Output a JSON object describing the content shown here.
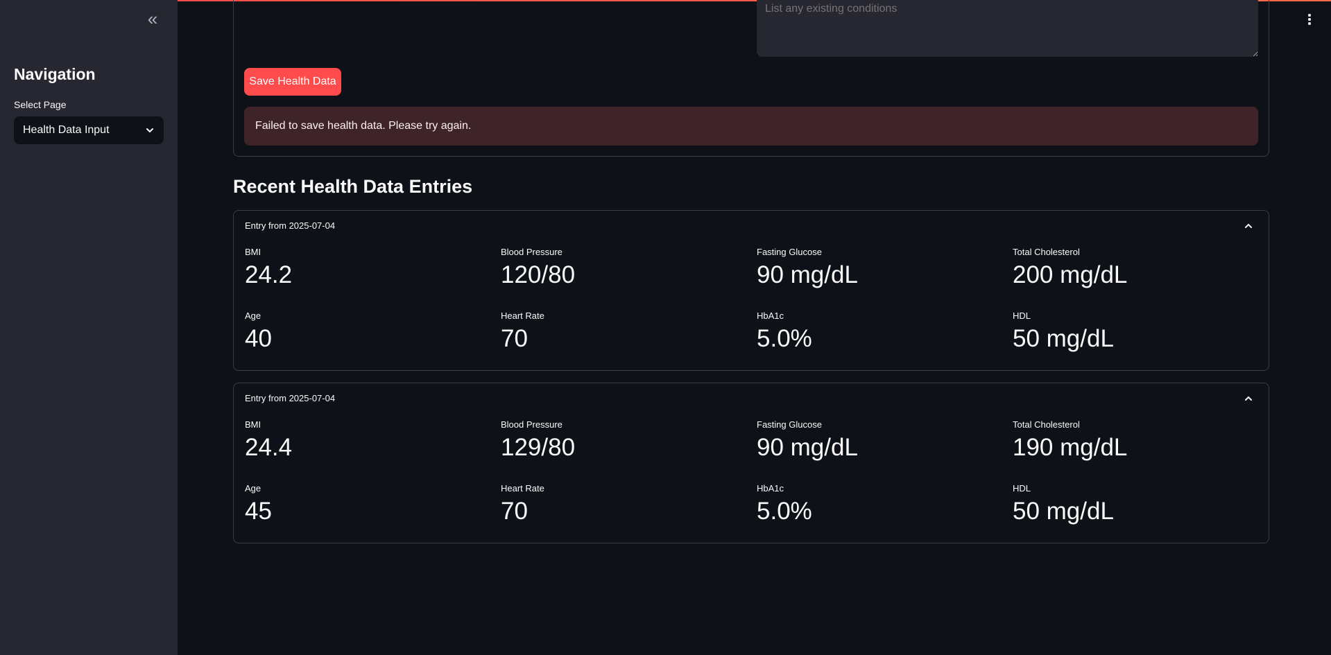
{
  "sidebar": {
    "title": "Navigation",
    "select_label": "Select Page",
    "selected_page": "Health Data Input"
  },
  "form": {
    "conditions_placeholder": "List any existing conditions",
    "save_label": "Save Health Data",
    "error_message": "Failed to save health data. Please try again."
  },
  "section_title": "Recent Health Data Entries",
  "entries": [
    {
      "header": "Entry from 2025-07-04",
      "metrics": [
        {
          "label": "BMI",
          "value": "24.2"
        },
        {
          "label": "Blood Pressure",
          "value": "120/80"
        },
        {
          "label": "Fasting Glucose",
          "value": "90 mg/dL"
        },
        {
          "label": "Total Cholesterol",
          "value": "200 mg/dL"
        },
        {
          "label": "Age",
          "value": "40"
        },
        {
          "label": "Heart Rate",
          "value": "70"
        },
        {
          "label": "HbA1c",
          "value": "5.0%"
        },
        {
          "label": "HDL",
          "value": "50 mg/dL"
        }
      ]
    },
    {
      "header": "Entry from 2025-07-04",
      "metrics": [
        {
          "label": "BMI",
          "value": "24.4"
        },
        {
          "label": "Blood Pressure",
          "value": "129/80"
        },
        {
          "label": "Fasting Glucose",
          "value": "90 mg/dL"
        },
        {
          "label": "Total Cholesterol",
          "value": "190 mg/dL"
        },
        {
          "label": "Age",
          "value": "45"
        },
        {
          "label": "Heart Rate",
          "value": "70"
        },
        {
          "label": "HbA1c",
          "value": "5.0%"
        },
        {
          "label": "HDL",
          "value": "50 mg/dL"
        }
      ]
    }
  ],
  "colors": {
    "accent": "#ff4b4b",
    "background": "#0e1117",
    "sidebar": "#262730",
    "error_bg": "#3e2428"
  }
}
